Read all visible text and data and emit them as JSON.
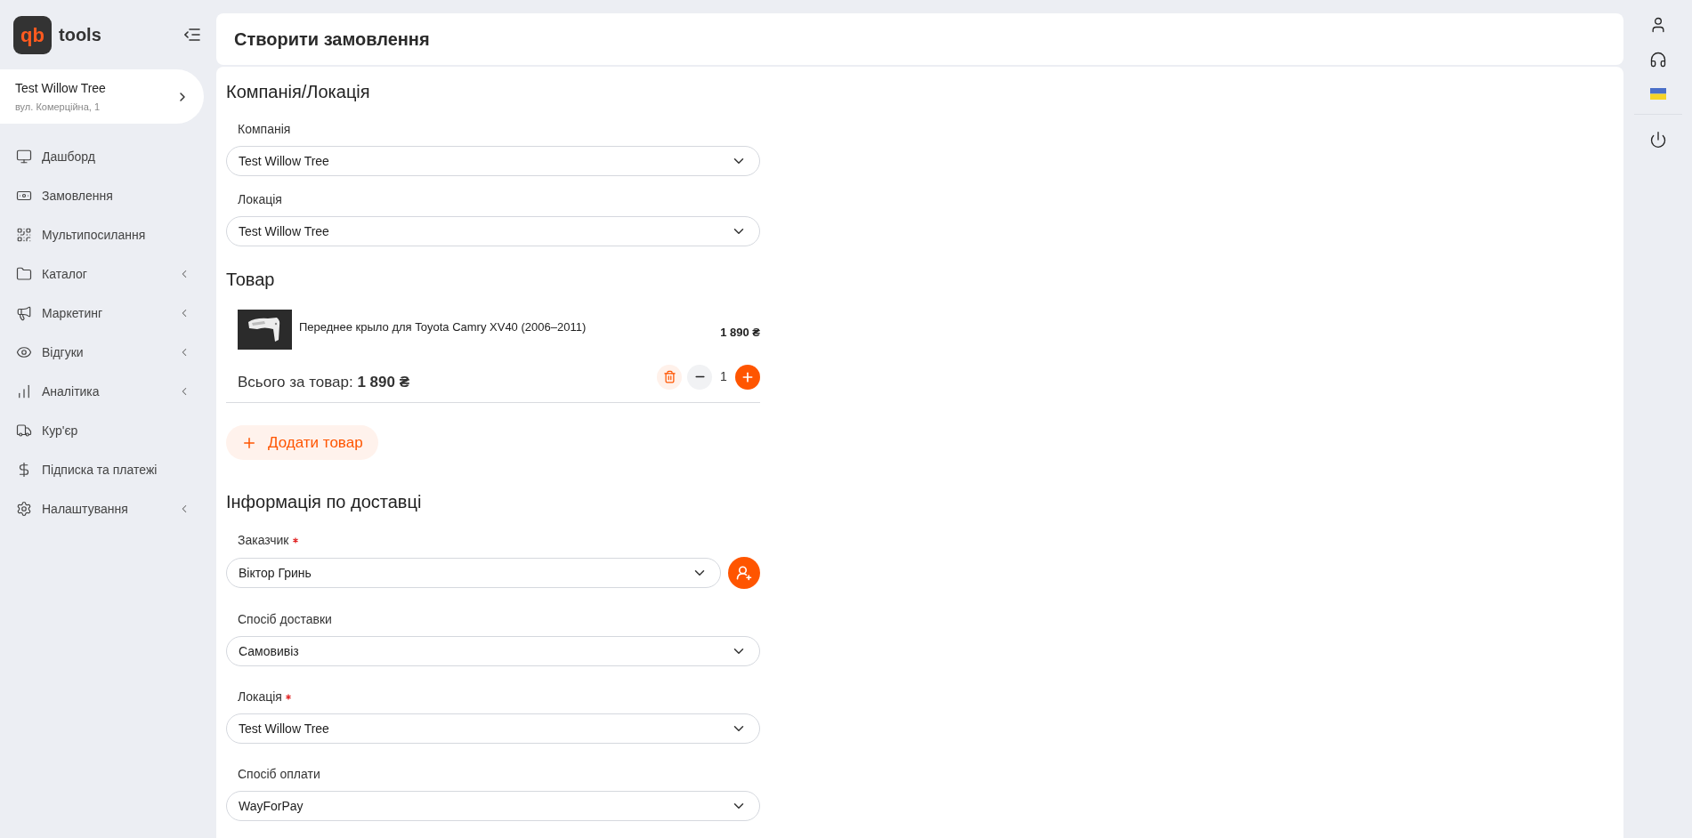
{
  "logo": {
    "mark": "qb",
    "text": "tools"
  },
  "location_card": {
    "name": "Test Willow Tree",
    "address": "вул. Комерційна, 1"
  },
  "sidebar": {
    "items": [
      {
        "label": "Дашборд",
        "expandable": false
      },
      {
        "label": "Замовлення",
        "expandable": false
      },
      {
        "label": "Мультипосилання",
        "expandable": false
      },
      {
        "label": "Каталог",
        "expandable": true
      },
      {
        "label": "Маркетинг",
        "expandable": true
      },
      {
        "label": "Відгуки",
        "expandable": true
      },
      {
        "label": "Аналітика",
        "expandable": true
      },
      {
        "label": "Кур'єр",
        "expandable": false
      },
      {
        "label": "Підписка та платежі",
        "expandable": false
      },
      {
        "label": "Налаштування",
        "expandable": true
      }
    ]
  },
  "page_title": "Створити замовлення",
  "company_section": {
    "title": "Компанія/Локація",
    "fields": [
      {
        "label": "Компанія",
        "value": "Test Willow Tree",
        "required": false,
        "kind": "select"
      },
      {
        "label": "Локація",
        "value": "Test Willow Tree",
        "required": false,
        "kind": "select"
      }
    ]
  },
  "product_section": {
    "title": "Товар",
    "item": {
      "name": "Переднее крыло для Toyota Camry XV40 (2006–2011)",
      "price": "1 890 ₴",
      "quantity": "1"
    },
    "total_label": "Всього за товар:",
    "total_value": "1 890 ₴",
    "add_button": "Додати товар"
  },
  "delivery_section": {
    "title": "Інформація по доставці",
    "fields": [
      {
        "label": "Заказчик",
        "value": "Віктор Гринь",
        "required": true,
        "kind": "select_with_add"
      },
      {
        "label": "Спосіб доставки",
        "value": "Самовивіз",
        "required": false,
        "kind": "select"
      },
      {
        "label": "Локація",
        "value": "Test Willow Tree",
        "required": true,
        "kind": "select"
      },
      {
        "label": "Спосіб оплати",
        "value": "WayForPay",
        "required": false,
        "kind": "select"
      }
    ]
  }
}
